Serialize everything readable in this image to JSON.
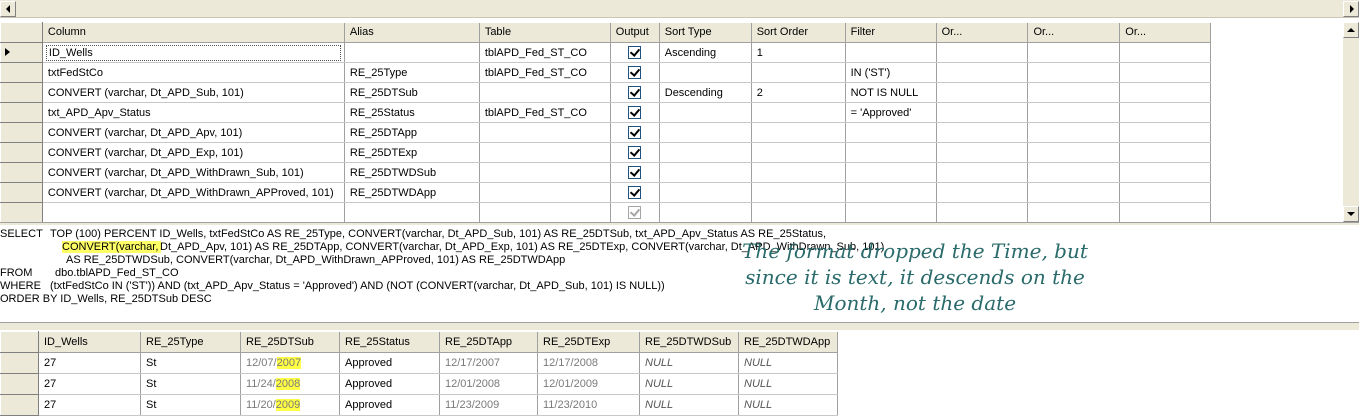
{
  "criteria": {
    "columns": [
      "Column",
      "Alias",
      "Table",
      "Output",
      "Sort Type",
      "Sort Order",
      "Filter",
      "Or...",
      "Or...",
      "Or..."
    ],
    "rows": [
      {
        "column": "ID_Wells",
        "alias": "",
        "table": "tblAPD_Fed_ST_CO",
        "output": true,
        "sort_type": "Ascending",
        "sort_order": "1",
        "filter": ""
      },
      {
        "column": "txtFedStCo",
        "alias": "RE_25Type",
        "table": "tblAPD_Fed_ST_CO",
        "output": true,
        "sort_type": "",
        "sort_order": "",
        "filter": "IN ('ST')"
      },
      {
        "column": "CONVERT (varchar, Dt_APD_Sub, 101)",
        "alias": "RE_25DTSub",
        "table": "",
        "output": true,
        "sort_type": "Descending",
        "sort_order": "2",
        "filter": "NOT IS NULL"
      },
      {
        "column": "txt_APD_Apv_Status",
        "alias": "RE_25Status",
        "table": "tblAPD_Fed_ST_CO",
        "output": true,
        "sort_type": "",
        "sort_order": "",
        "filter": "= 'Approved'"
      },
      {
        "column": "CONVERT (varchar, Dt_APD_Apv, 101)",
        "alias": "RE_25DTApp",
        "table": "",
        "output": true,
        "sort_type": "",
        "sort_order": "",
        "filter": ""
      },
      {
        "column": "CONVERT (varchar, Dt_APD_Exp, 101)",
        "alias": "RE_25DTExp",
        "table": "",
        "output": true,
        "sort_type": "",
        "sort_order": "",
        "filter": ""
      },
      {
        "column": "CONVERT (varchar, Dt_APD_WithDrawn_Sub, 101)",
        "alias": "RE_25DTWDSub",
        "table": "",
        "output": true,
        "sort_type": "",
        "sort_order": "",
        "filter": ""
      },
      {
        "column": "CONVERT (varchar, Dt_APD_WithDrawn_APProved, 101)",
        "alias": "RE_25DTWDApp",
        "table": "",
        "output": true,
        "sort_type": "",
        "sort_order": "",
        "filter": ""
      },
      {
        "column": "",
        "alias": "",
        "table": "",
        "output": true,
        "sort_type": "",
        "sort_order": "",
        "filter": ""
      }
    ]
  },
  "sql": {
    "l1_kw": "SELECT",
    "l1": "TOP (100) PERCENT ID_Wells, txtFedStCo AS RE_25Type, CONVERT(varchar, Dt_APD_Sub, 101) AS RE_25DTSub, txt_APD_Apv_Status AS RE_25Status,",
    "l2_hl": "CONVERT(varchar, ",
    "l2": "Dt_APD_Apv, 101) AS RE_25DTApp, CONVERT(varchar, Dt_APD_Exp, 101) AS RE_25DTExp, CONVERT(varchar, Dt_APD_WithDrawn_Sub, 101)",
    "l3": "AS RE_25DTWDSub, CONVERT(varchar, Dt_APD_WithDrawn_APProved, 101) AS RE_25DTWDApp",
    "l4_kw": "FROM",
    "l4": "dbo.tblAPD_Fed_ST_CO",
    "l5_kw": "WHERE",
    "l5": "(txtFedStCo IN ('ST')) AND (txt_APD_Apv_Status = 'Approved') AND (NOT (CONVERT(varchar, Dt_APD_Sub, 101) IS NULL))",
    "l6": "ORDER BY ID_Wells, RE_25DTSub DESC"
  },
  "annotation": {
    "line1": "The format dropped the Time, but",
    "line2": "since  it is text, it descends on the",
    "line3": "Month, not the date"
  },
  "results": {
    "headers": [
      "ID_Wells",
      "RE_25Type",
      "RE_25DTSub",
      "RE_25Status",
      "RE_25DTApp",
      "RE_25DTExp",
      "RE_25DTWDSub",
      "RE_25DTWDApp"
    ],
    "rows": [
      {
        "id": "27",
        "type": "St",
        "sub_md": "12/07/",
        "sub_y": "2007",
        "status": "Approved",
        "app": "12/17/2007",
        "exp": "12/17/2008",
        "wdsub": "NULL",
        "wdapp": "NULL"
      },
      {
        "id": "27",
        "type": "St",
        "sub_md": "11/24/",
        "sub_y": "2008",
        "status": "Approved",
        "app": "12/01/2008",
        "exp": "12/01/2009",
        "wdsub": "NULL",
        "wdapp": "NULL"
      },
      {
        "id": "27",
        "type": "St",
        "sub_md": "11/20/",
        "sub_y": "2009",
        "status": "Approved",
        "app": "11/23/2009",
        "exp": "11/23/2010",
        "wdsub": "NULL",
        "wdapp": "NULL"
      }
    ]
  }
}
